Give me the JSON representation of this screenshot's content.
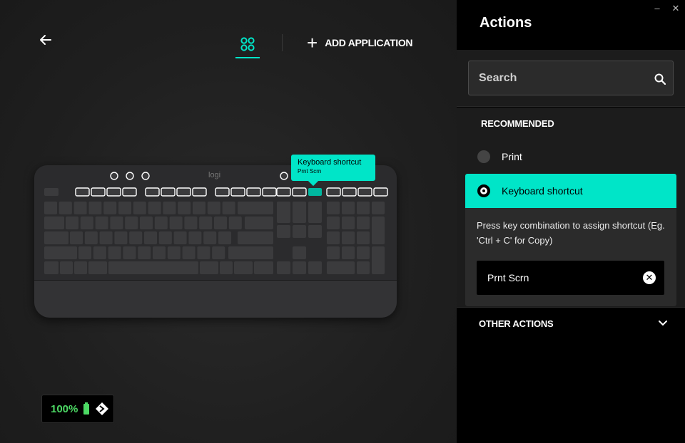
{
  "window": {
    "minimize_symbol": "–",
    "close_symbol": "✕"
  },
  "toolbar": {
    "add_application_label": "ADD APPLICATION",
    "plus_symbol": "+"
  },
  "keyboard": {
    "brand_logo": "logi",
    "tooltip_title": "Keyboard shortcut",
    "tooltip_subtitle": "Prnt Scrn"
  },
  "battery": {
    "percent": "100%"
  },
  "actions": {
    "title": "Actions",
    "search_placeholder": "Search",
    "recommended_label": "RECOMMENDED",
    "options": [
      {
        "label": "Print",
        "selected": false
      },
      {
        "label": "Keyboard shortcut",
        "selected": true
      }
    ],
    "shortcut_help": "Press key combination to assign shortcut (Eg. 'Ctrl + C' for Copy)",
    "shortcut_value": "Prnt Scrn",
    "other_actions_label": "OTHER ACTIONS"
  },
  "colors": {
    "accent": "#00e5c8",
    "battery_green": "#4cd964"
  }
}
